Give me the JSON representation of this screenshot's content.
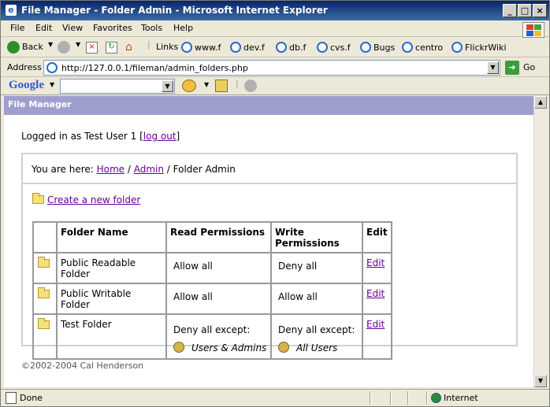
{
  "window": {
    "title": "File Manager - Folder Admin - Microsoft Internet Explorer",
    "menu": [
      "File",
      "Edit",
      "View",
      "Favorites",
      "Tools",
      "Help"
    ]
  },
  "toolbar": {
    "back_label": "Back",
    "links_label": "Links",
    "links": [
      "www.f",
      "dev.f",
      "db.f",
      "cvs.f",
      "Bugs",
      "centro",
      "FlickrWiki"
    ]
  },
  "address": {
    "label": "Address",
    "url": "http://127.0.0.1/fileman/admin_folders.php",
    "go_label": "Go"
  },
  "google": {
    "logo": "Google",
    "search_value": ""
  },
  "page": {
    "app_title": "File Manager",
    "logged_in_prefix": "Logged in as Test User 1 [",
    "logout_label": "log out",
    "logged_in_suffix": "]",
    "breadcrumb_prefix": "You are here: ",
    "breadcrumb_home": "Home",
    "breadcrumb_admin": "Admin",
    "breadcrumb_current": "Folder Admin",
    "breadcrumb_sep": " / ",
    "create_folder_label": "Create a new folder",
    "table": {
      "headers": [
        "Folder Name",
        "Read Permissions",
        "Write Permissions",
        "Edit"
      ],
      "rows": [
        {
          "name": "Public Readable Folder",
          "read": "Allow all",
          "read_extra": "",
          "write": "Deny all",
          "write_extra": "",
          "edit": "Edit"
        },
        {
          "name": "Public Writable Folder",
          "read": "Allow all",
          "read_extra": "",
          "write": "Allow all",
          "write_extra": "",
          "edit": "Edit"
        },
        {
          "name": "Test Folder",
          "read": "Deny all except:",
          "read_extra": "Users & Admins",
          "write": "Deny all except:",
          "write_extra": "All Users",
          "edit": "Edit"
        }
      ]
    },
    "footer": "©2002-2004 Cal Henderson"
  },
  "status": {
    "text": "Done",
    "zone": "Internet"
  }
}
